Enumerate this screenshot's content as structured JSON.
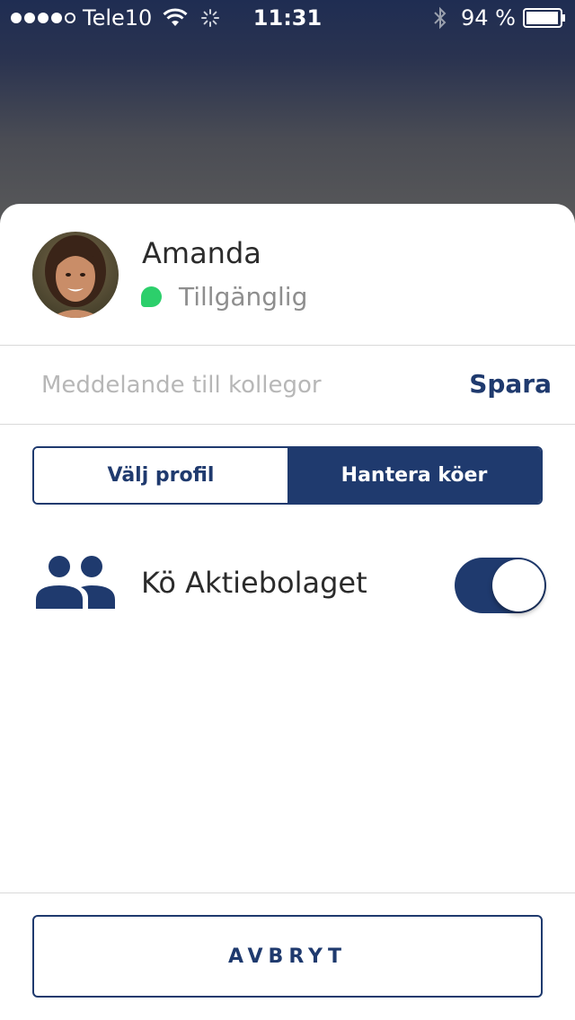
{
  "status_bar": {
    "carrier": "Tele10",
    "time": "11:31",
    "battery_percent": "94 %",
    "icons": [
      "signal-dots-icon",
      "wifi-icon",
      "activity-spinner-icon",
      "bluetooth-icon",
      "battery-icon"
    ]
  },
  "profile": {
    "name": "Amanda",
    "status": "Tillgänglig",
    "status_color": "#2ccf6b"
  },
  "message": {
    "placeholder": "Meddelande till kollegor",
    "value": "",
    "save_label": "Spara"
  },
  "tabs": [
    {
      "label": "Välj profil",
      "active": false
    },
    {
      "label": "Hantera köer",
      "active": true
    }
  ],
  "queues": [
    {
      "label": "Kö Aktiebolaget",
      "enabled": true,
      "icon": "people-group-icon"
    }
  ],
  "cancel_label": "AVBRYT",
  "colors": {
    "accent": "#1f3a6e",
    "available": "#2ccf6b"
  }
}
